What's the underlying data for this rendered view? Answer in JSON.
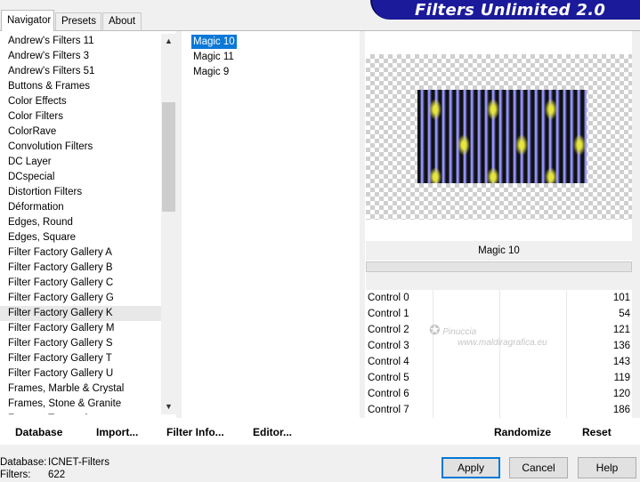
{
  "tabs": [
    "Navigator",
    "Presets",
    "About"
  ],
  "banner": {
    "title": "Filters Unlimited 2.0"
  },
  "categories": [
    "Andrew's Filters 11",
    "Andrew's Filters 3",
    "Andrew's Filters 51",
    "Buttons & Frames",
    "Color Effects",
    "Color Filters",
    "ColorRave",
    "Convolution Filters",
    "DC Layer",
    "DCspecial",
    "Distortion Filters",
    "Déformation",
    "Edges, Round",
    "Edges, Square",
    "Filter Factory Gallery A",
    "Filter Factory Gallery B",
    "Filter Factory Gallery C",
    "Filter Factory Gallery G",
    "Filter Factory Gallery K",
    "Filter Factory Gallery M",
    "Filter Factory Gallery S",
    "Filter Factory Gallery T",
    "Filter Factory Gallery U",
    "Frames, Marble & Crystal",
    "Frames, Stone & Granite",
    "Frames, Textured"
  ],
  "highlighted_category": "Filter Factory Gallery K",
  "filters": [
    "Magic 10",
    "Magic 11",
    "Magic 9"
  ],
  "selected_filter": "Magic 10",
  "preview": {
    "filter_name": "Magic 10",
    "watermark_name": "Pinuccia",
    "watermark_url": "www.maldiragrafica.eu"
  },
  "controls": [
    {
      "label": "Control 0",
      "value": 101
    },
    {
      "label": "Control 1",
      "value": 54
    },
    {
      "label": "Control 2",
      "value": 121
    },
    {
      "label": "Control 3",
      "value": 136
    },
    {
      "label": "Control 4",
      "value": 143
    },
    {
      "label": "Control 5",
      "value": 119
    },
    {
      "label": "Control 6",
      "value": 120
    },
    {
      "label": "Control 7",
      "value": 186
    }
  ],
  "bottom_buttons": {
    "database": "Database",
    "import": "Import...",
    "filter_info": "Filter Info...",
    "editor": "Editor...",
    "randomize": "Randomize",
    "reset": "Reset"
  },
  "status": {
    "database_label": "Database:",
    "database_value": "ICNET-Filters",
    "filters_label": "Filters:",
    "filters_value": "622"
  },
  "dialog_buttons": {
    "apply": "Apply",
    "cancel": "Cancel",
    "help": "Help"
  },
  "colors": {
    "banner": "#1a1a9a",
    "selection": "#0a78d7"
  }
}
